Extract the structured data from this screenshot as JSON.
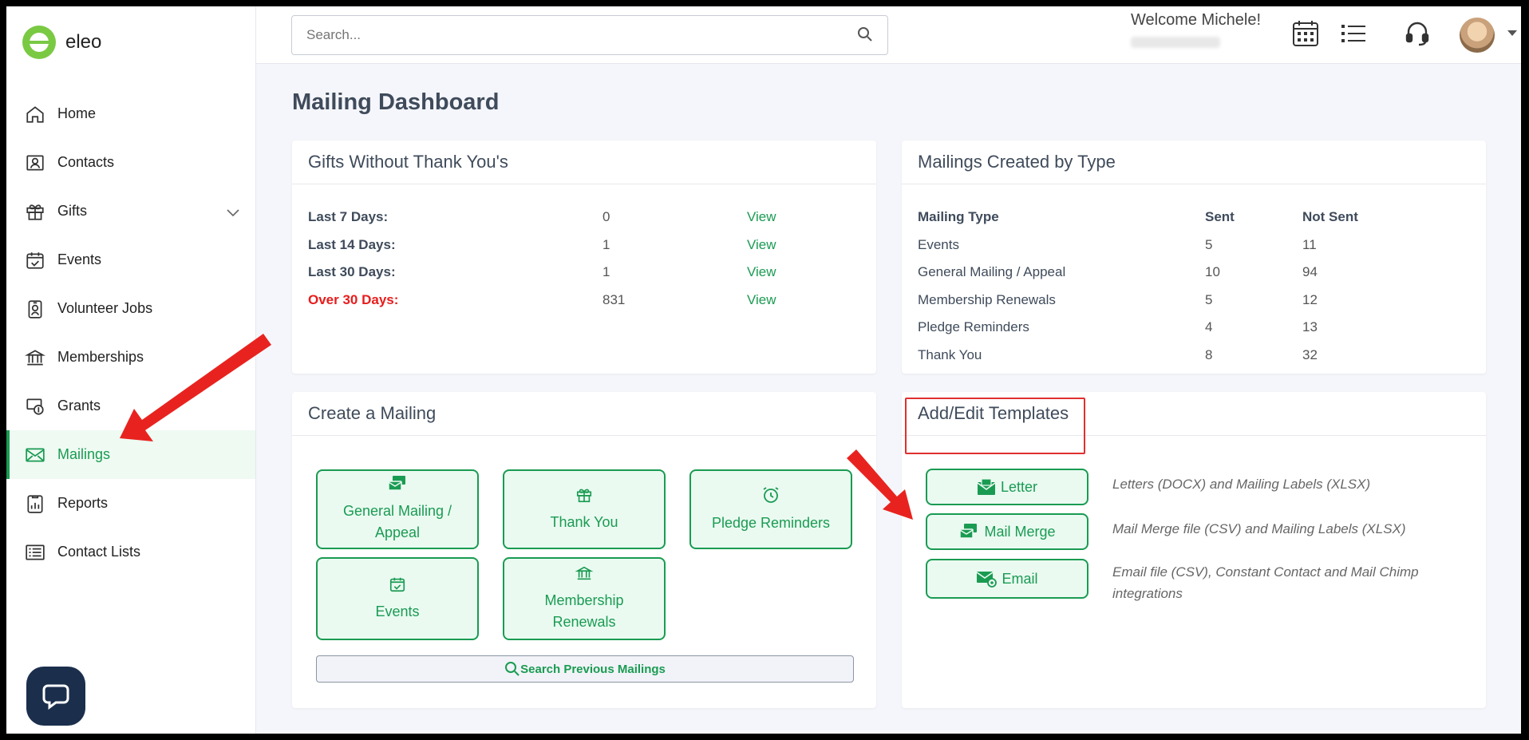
{
  "brand": {
    "name": "eleo"
  },
  "sidebar": {
    "items": [
      {
        "label": "Home",
        "icon": "home-icon"
      },
      {
        "label": "Contacts",
        "icon": "contact-card-icon"
      },
      {
        "label": "Gifts",
        "icon": "gift-icon"
      },
      {
        "label": "Events",
        "icon": "calendar-check-icon"
      },
      {
        "label": "Volunteer Jobs",
        "icon": "badge-icon"
      },
      {
        "label": "Memberships",
        "icon": "bank-icon"
      },
      {
        "label": "Grants",
        "icon": "money-icon"
      },
      {
        "label": "Mailings",
        "icon": "envelope-icon",
        "active": true
      },
      {
        "label": "Reports",
        "icon": "report-icon"
      },
      {
        "label": "Contact Lists",
        "icon": "list-icon"
      }
    ]
  },
  "header": {
    "search_placeholder": "Search...",
    "welcome": "Welcome Michele!"
  },
  "page": {
    "title": "Mailing Dashboard"
  },
  "gifts_card": {
    "title": "Gifts Without Thank You's",
    "rows": [
      {
        "label": "Last 7 Days:",
        "value": "0",
        "link": "View"
      },
      {
        "label": "Last 14 Days:",
        "value": "1",
        "link": "View"
      },
      {
        "label": "Last 30 Days:",
        "value": "1",
        "link": "View"
      },
      {
        "label": "Over 30 Days:",
        "value": "831",
        "link": "View"
      }
    ]
  },
  "mailings_type_card": {
    "title": "Mailings Created by Type",
    "headers": [
      "Mailing Type",
      "Sent",
      "Not Sent"
    ],
    "rows": [
      [
        "Events",
        "5",
        "11"
      ],
      [
        "General Mailing / Appeal",
        "10",
        "94"
      ],
      [
        "Membership Renewals",
        "5",
        "12"
      ],
      [
        "Pledge Reminders",
        "4",
        "13"
      ],
      [
        "Thank You",
        "8",
        "32"
      ]
    ]
  },
  "create_card": {
    "title": "Create a Mailing",
    "tiles": {
      "general_l1": "General Mailing /",
      "general_l2": "Appeal",
      "thank_you": "Thank You",
      "pledge": "Pledge Reminders",
      "events": "Events",
      "membership_l1": "Membership",
      "membership_l2": "Renewals"
    },
    "search_previous": "Search Previous Mailings"
  },
  "templates_card": {
    "title": "Add/Edit Templates",
    "buttons": [
      {
        "label": "Letter",
        "desc": "Letters (DOCX) and Mailing Labels (XLSX)"
      },
      {
        "label": "Mail Merge",
        "desc": "Mail Merge file (CSV) and Mailing Labels (XLSX)"
      },
      {
        "label": "Email",
        "desc": "Email file (CSV), Constant Contact and Mail Chimp integrations"
      }
    ]
  },
  "colors": {
    "accent": "#1a9b52",
    "danger": "#e81c1c",
    "annotation": "#e03030",
    "logo": "#7ac943"
  }
}
